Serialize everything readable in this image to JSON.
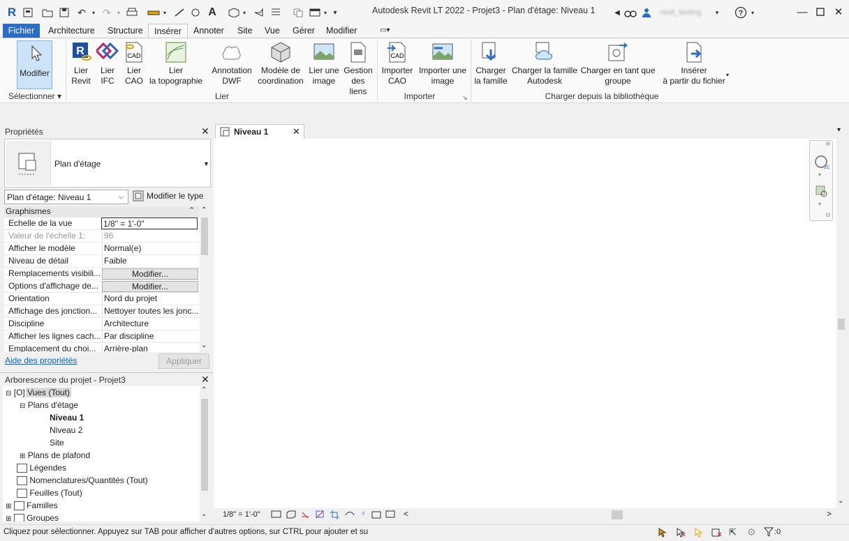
{
  "app": {
    "title": "Autodesk Revit LT 2022 - Projet3 - Plan d'étage: Niveau 1",
    "user_label": "revit_testing",
    "logo": "R"
  },
  "menu_tabs": [
    "Fichier",
    "Architecture",
    "Structure",
    "Insérer",
    "Annoter",
    "Site",
    "Vue",
    "Gérer",
    "Modifier"
  ],
  "ribbon": {
    "modify": {
      "label": "Modifier"
    },
    "select_group": "Sélectionner",
    "link_buttons": [
      {
        "l1": "Lier",
        "l2": "Revit"
      },
      {
        "l1": "Lier",
        "l2": "IFC"
      },
      {
        "l1": "Lier",
        "l2": "CAO"
      },
      {
        "l1": "Lier",
        "l2": "la topographie"
      },
      {
        "l1": "Annotation",
        "l2": "DWF"
      },
      {
        "l1": "Modèle de",
        "l2": "coordination"
      },
      {
        "l1": "Lier une",
        "l2": "image"
      },
      {
        "l1": "Gestion",
        "l2": "des liens"
      }
    ],
    "link_group": "Lier",
    "import_buttons": [
      {
        "l1": "Importer",
        "l2": "CAO"
      },
      {
        "l1": "Importer une",
        "l2": "image"
      }
    ],
    "import_group": "Importer",
    "load_buttons": [
      {
        "l1": "Charger",
        "l2": "la famille"
      },
      {
        "l1": "Charger la famille",
        "l2": "Autodesk"
      },
      {
        "l1": "Charger en tant que",
        "l2": "groupe"
      },
      {
        "l1": "Insérer",
        "l2": "à partir du fichier"
      }
    ],
    "load_group": "Charger depuis la bibliothèque"
  },
  "properties": {
    "title": "Propriétés",
    "type_name": "Plan d'étage",
    "instance_select": "Plan d'étage: Niveau 1",
    "edit_type": "Modifier le type",
    "section": "Graphismes",
    "rows": [
      {
        "k": "Echelle de la vue",
        "v": "1/8\" = 1'-0\""
      },
      {
        "k": "Valeur de l'échelle    1:",
        "v": "96"
      },
      {
        "k": "Afficher le modèle",
        "v": "Normal(e)"
      },
      {
        "k": "Niveau de détail",
        "v": "Faible"
      },
      {
        "k": "Remplacements visibili...",
        "v": "Modifier..."
      },
      {
        "k": "Options d'affichage de...",
        "v": "Modifier..."
      },
      {
        "k": "Orientation",
        "v": "Nord du projet"
      },
      {
        "k": "Affichage des jonction...",
        "v": "Nettoyer toutes les jonc..."
      },
      {
        "k": "Discipline",
        "v": "Architecture"
      },
      {
        "k": "Afficher les lignes cach...",
        "v": "Par discipline"
      },
      {
        "k": "Emplacement du choi...",
        "v": "Arrière-plan"
      }
    ],
    "help_link": "Aide des propriétés",
    "apply": "Appliquer"
  },
  "browser": {
    "title": "Arborescence du projet - Projet3",
    "views": "Vues (Tout)",
    "plans": "Plans d'étage",
    "n1": "Niveau 1",
    "n2": "Niveau 2",
    "site": "Site",
    "ceiling": "Plans de plafond",
    "legends": "Légendes",
    "schedules": "Nomenclatures/Quantités (Tout)",
    "sheets": "Feuilles (Tout)",
    "families": "Familles",
    "groups": "Groupes"
  },
  "view_tab": {
    "label": "Niveau 1"
  },
  "view_bar": {
    "scale": "1/8\" = 1'-0\""
  },
  "status": {
    "message": "Cliquez pour sélectionner. Appuyez sur TAB pour afficher d'autres options, sur CTRL pour ajouter et su",
    "filter_count": ":0"
  },
  "colors": {
    "file_tab": "#2b6cc4",
    "accent": "#2b6cc4",
    "link": "#0066cc"
  }
}
